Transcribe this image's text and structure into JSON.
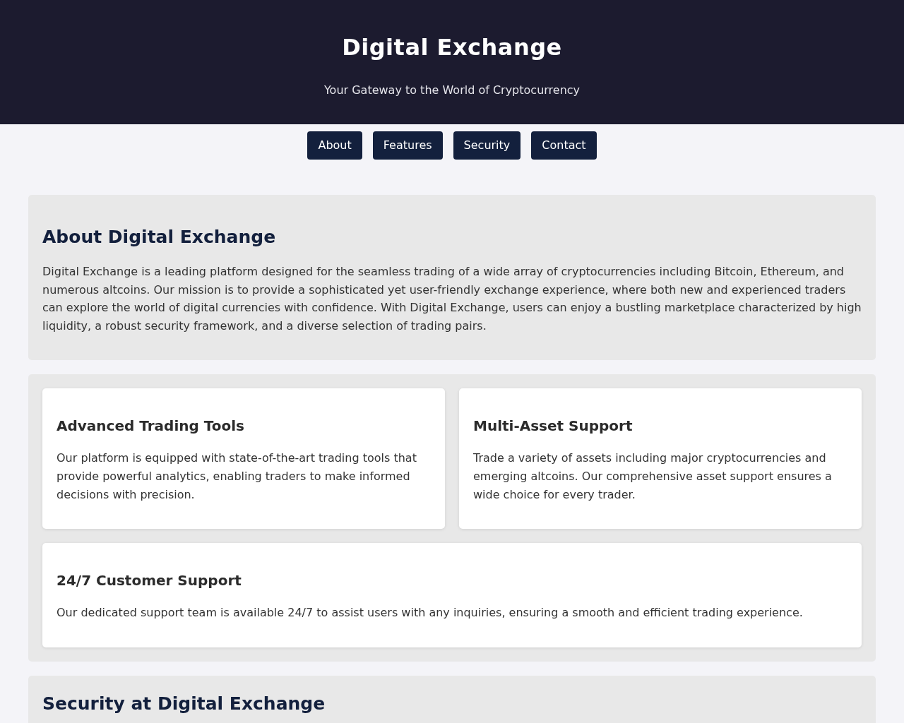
{
  "header": {
    "title": "Digital Exchange",
    "subtitle": "Your Gateway to the World of Cryptocurrency"
  },
  "nav": [
    {
      "label": "About"
    },
    {
      "label": "Features"
    },
    {
      "label": "Security"
    },
    {
      "label": "Contact"
    }
  ],
  "about": {
    "heading": "About Digital Exchange",
    "text": "Digital Exchange is a leading platform designed for the seamless trading of a wide array of cryptocurrencies including Bitcoin, Ethereum, and numerous altcoins. Our mission is to provide a sophisticated yet user-friendly exchange experience, where both new and experienced traders can explore the world of digital currencies with confidence. With Digital Exchange, users can enjoy a bustling marketplace characterized by high liquidity, a robust security framework, and a diverse selection of trading pairs."
  },
  "features": [
    {
      "title": "Advanced Trading Tools",
      "text": "Our platform is equipped with state-of-the-art trading tools that provide powerful analytics, enabling traders to make informed decisions with precision."
    },
    {
      "title": "Multi-Asset Support",
      "text": "Trade a variety of assets including major cryptocurrencies and emerging altcoins. Our comprehensive asset support ensures a wide choice for every trader."
    },
    {
      "title": "24/7 Customer Support",
      "text": "Our dedicated support team is available 24/7 to assist users with any inquiries, ensuring a smooth and efficient trading experience."
    }
  ],
  "security": {
    "heading": "Security at Digital Exchange"
  }
}
